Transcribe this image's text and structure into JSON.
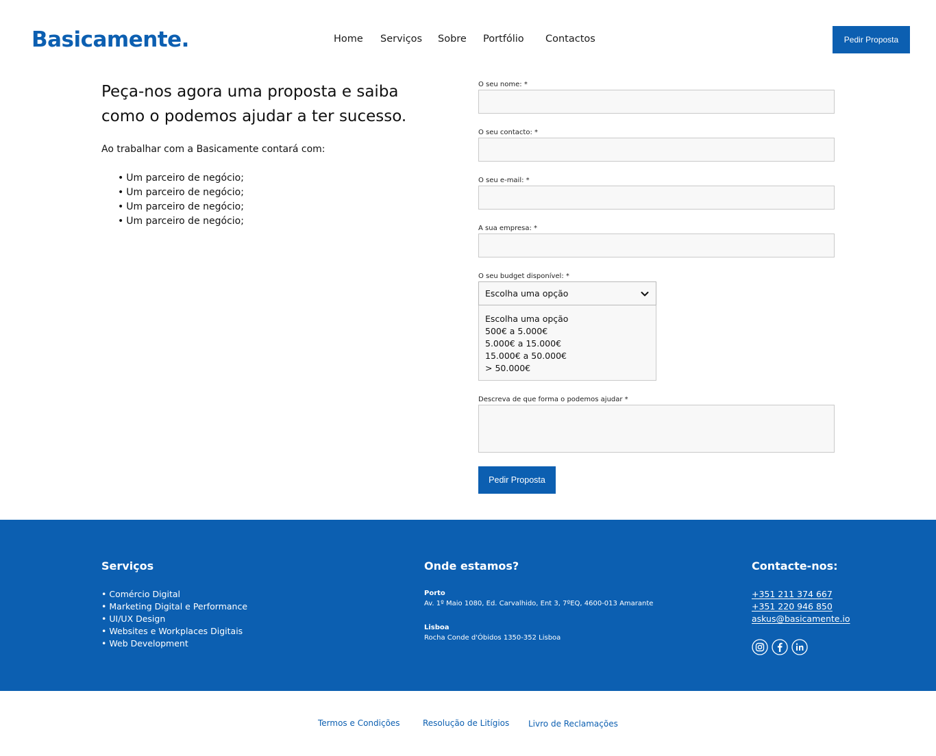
{
  "header": {
    "logo": "Basicamente.",
    "nav": [
      "Home",
      "Serviços",
      "Sobre",
      "Portfólio",
      "Contactos"
    ],
    "cta": "Pedir Proposta"
  },
  "intro": {
    "title": "Peça-nos agora uma proposta e saiba como o podemos ajudar a ter sucesso.",
    "subtitle": "Ao trabalhar com a Basicamente contará com:",
    "items": [
      "Um parceiro de negócio;",
      "Um parceiro de negócio;",
      "Um parceiro de negócio;",
      "Um parceiro de negócio;"
    ]
  },
  "form": {
    "name_label": "O seu nome: *",
    "contact_label": "O seu contacto: *",
    "email_label": "O seu e-mail: *",
    "company_label": "A sua empresa: *",
    "budget_label": "O seu budget disponível: *",
    "budget_selected": "Escolha uma opção",
    "budget_options": [
      "Escolha uma opção",
      "500€ a 5.000€",
      "5.000€ a 15.000€",
      "15.000€ a 50.000€",
      "> 50.000€"
    ],
    "description_label": "Descreva de que forma o podemos ajudar *",
    "submit": "Pedir Proposta"
  },
  "footer": {
    "services": {
      "heading": "Serviços",
      "items": [
        "Comércio Digital",
        "Marketing Digital e Performance",
        "UI/UX Design",
        "Websites e Workplaces Digitais",
        "Web Development"
      ]
    },
    "locations": {
      "heading": "Onde estamos?",
      "items": [
        {
          "name": "Porto",
          "address": "Av. 1º Maio 1080, Ed. Carvalhido, Ent 3, 7ºEQ, 4600-013 Amarante"
        },
        {
          "name": "Lisboa",
          "address": "Rocha Conde d'Óbidos 1350-352 Lisboa"
        }
      ]
    },
    "contact": {
      "heading": "Contacte-nos:",
      "phone1": "+351 211 374 667",
      "phone2": "+351 220 946 850",
      "email": "askus@basicamente.io",
      "social_icons": [
        "instagram-icon",
        "facebook-icon",
        "linkedin-icon"
      ]
    }
  },
  "bottom_links": [
    "Termos e Condições",
    "Resolução de Litígios",
    "Livro de Reclamações"
  ],
  "colors": {
    "brand": "#0c5fb1",
    "input_bg": "#f8f8f8"
  }
}
